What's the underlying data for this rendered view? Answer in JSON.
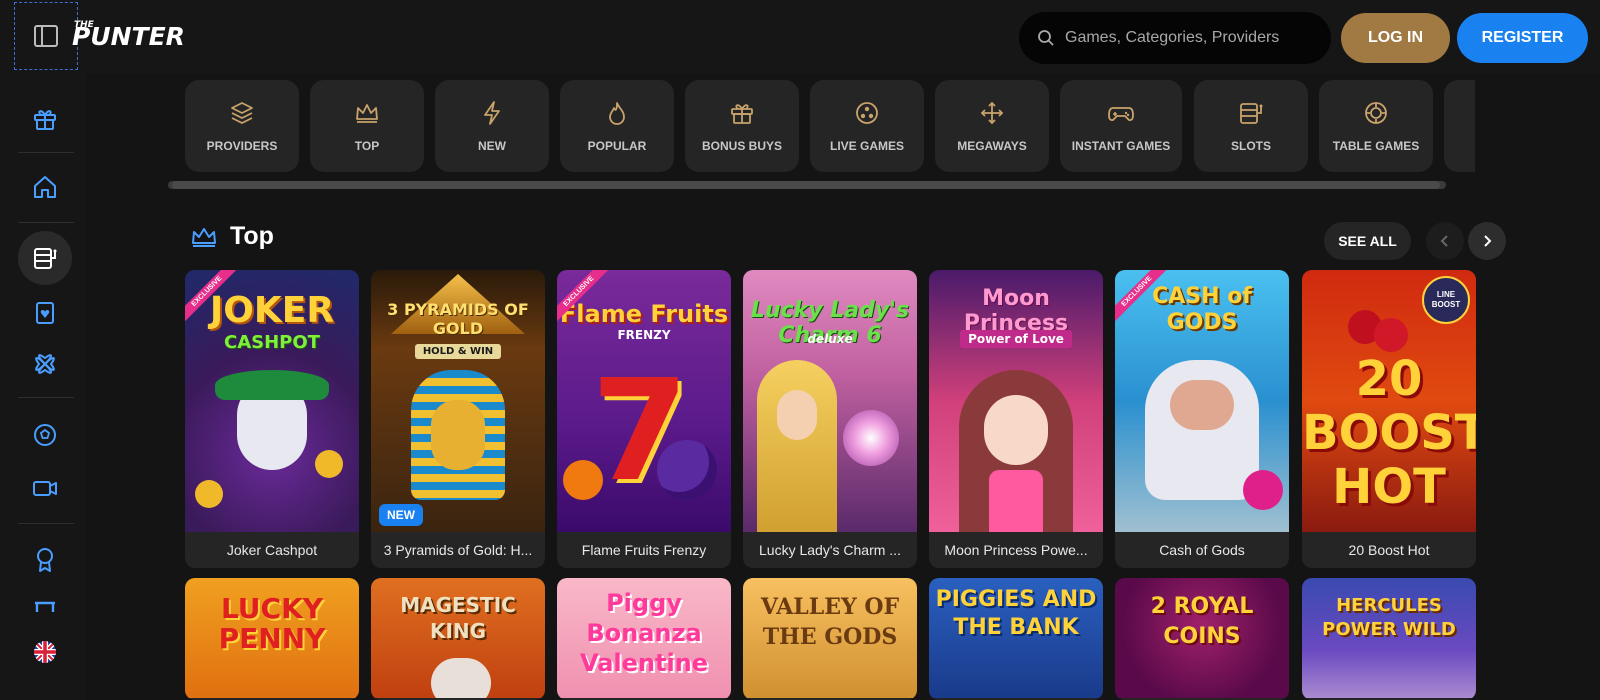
{
  "brand": {
    "logo_prefix": "THE",
    "logo_text": "PUNTER"
  },
  "search": {
    "placeholder": "Games, Categories, Providers"
  },
  "auth": {
    "login": "LOG IN",
    "register": "REGISTER"
  },
  "sidebar": {
    "items": [
      {
        "name": "gift-icon"
      },
      {
        "name": "home-icon"
      },
      {
        "name": "slot-machine-icon",
        "active": true
      },
      {
        "name": "card-icon"
      },
      {
        "name": "clover-icon"
      },
      {
        "name": "football-icon"
      },
      {
        "name": "video-icon"
      },
      {
        "name": "award-icon"
      },
      {
        "name": "bench-icon"
      },
      {
        "name": "uk-flag-icon"
      }
    ]
  },
  "categories": [
    {
      "label": "PROVIDERS",
      "icon": "layers-icon"
    },
    {
      "label": "TOP",
      "icon": "crown-icon"
    },
    {
      "label": "NEW",
      "icon": "lightning-icon"
    },
    {
      "label": "POPULAR",
      "icon": "flame-icon"
    },
    {
      "label": "BONUS BUYS",
      "icon": "gift-icon"
    },
    {
      "label": "LIVE GAMES",
      "icon": "live-icon"
    },
    {
      "label": "MEGAWAYS",
      "icon": "arrows-icon"
    },
    {
      "label": "INSTANT GAMES",
      "icon": "gamepad-icon"
    },
    {
      "label": "SLOTS",
      "icon": "slot-machine-icon"
    },
    {
      "label": "TABLE GAMES",
      "icon": "chip-icon"
    }
  ],
  "section": {
    "title": "Top",
    "see_all": "SEE ALL"
  },
  "games_row1": [
    {
      "name": "Joker Cashpot",
      "art_title": "JOKER",
      "art_sub": "CASHPOT",
      "badge": "",
      "ribbon": "EXCLUSIVE"
    },
    {
      "name": "3 Pyramids of Gold: H...",
      "art_title": "3 PYRAMIDS OF GOLD",
      "art_sub": "HOLD & WIN",
      "badge": "NEW",
      "ribbon": ""
    },
    {
      "name": "Flame Fruits Frenzy",
      "art_title": "Flame Fruits",
      "art_sub": "FRENZY",
      "badge": "",
      "ribbon": "EXCLUSIVE"
    },
    {
      "name": "Lucky Lady's Charm ...",
      "art_title": "Lucky Lady's Charm 6",
      "art_sub": "deluxe",
      "badge": "",
      "ribbon": ""
    },
    {
      "name": "Moon Princess Powe...",
      "art_title": "Moon Princess",
      "art_sub": "Power of Love",
      "badge": "",
      "ribbon": ""
    },
    {
      "name": "Cash of Gods",
      "art_title": "CASH of GODS",
      "art_sub": "",
      "badge": "",
      "ribbon": "EXCLUSIVE"
    },
    {
      "name": "20 Boost Hot",
      "art_title": "20 BOOST HOT",
      "art_sub": "LINE BOOST",
      "badge": "",
      "ribbon": ""
    }
  ],
  "games_row2": [
    {
      "art_title": "LUCKY PENNY"
    },
    {
      "art_title": "MAGESTIC KING"
    },
    {
      "art_title": "Piggy Bonanza Valentine"
    },
    {
      "art_title": "VALLEY OF THE GODS"
    },
    {
      "art_title": "PIGGIES AND THE BANK"
    },
    {
      "art_title": "2 ROYAL COINS"
    },
    {
      "art_title": "HERCULES POWER WILD"
    }
  ],
  "colors": {
    "accent_gold": "#a07a42",
    "accent_blue": "#1a82f0",
    "icon_blue": "#4a9eff",
    "icon_gold": "#c9a36b"
  }
}
